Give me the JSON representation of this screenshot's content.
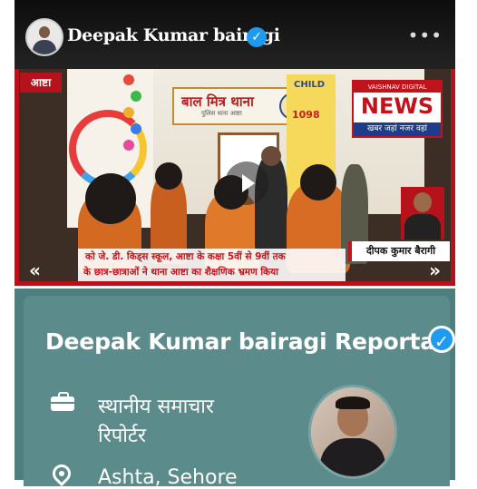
{
  "post": {
    "author_name": "Deepak Kumar bairagi",
    "verified_icon": "verified-badge-icon",
    "more_icon": "more-options-icon",
    "more_label": "•••",
    "video": {
      "location_tag": "आष्टा",
      "sign_text": "बाल मित्र थाना",
      "sign_subtext": "पुलिस थाना आष्टा",
      "child_text": "CHILD",
      "helpline": "1098",
      "news_brand_top": "VAISHNAV DIGITAL",
      "news_brand_big": "NEWS",
      "news_brand_bottom": "खबर जहां नजर वहां",
      "reporter_name": "दीपक कुमार बैरागी",
      "caption_line1": "को जे. डी. किड्स स्कूल, आष्टा के कक्षा 5वीं से 9वीं तक",
      "caption_line2": "के छात्र-छात्राओं ने थाना आष्टा का शैक्षणिक भ्रमण किया",
      "play_icon": "play-icon",
      "prev_label": "«",
      "next_label": "»"
    }
  },
  "profile": {
    "name": "Deepak Kumar bairagi Reportar",
    "verified_icon": "verified-badge-icon",
    "role_icon": "briefcase-icon",
    "role_line1": "स्थानीय समाचार",
    "role_line2": "रिपोर्टर",
    "location_icon": "location-pin-icon",
    "location": "Ashta, Sehore"
  },
  "colors": {
    "profile_bg": "#5b8c8b",
    "verified_blue": "#1d9bf0",
    "news_red": "#c0131b"
  }
}
